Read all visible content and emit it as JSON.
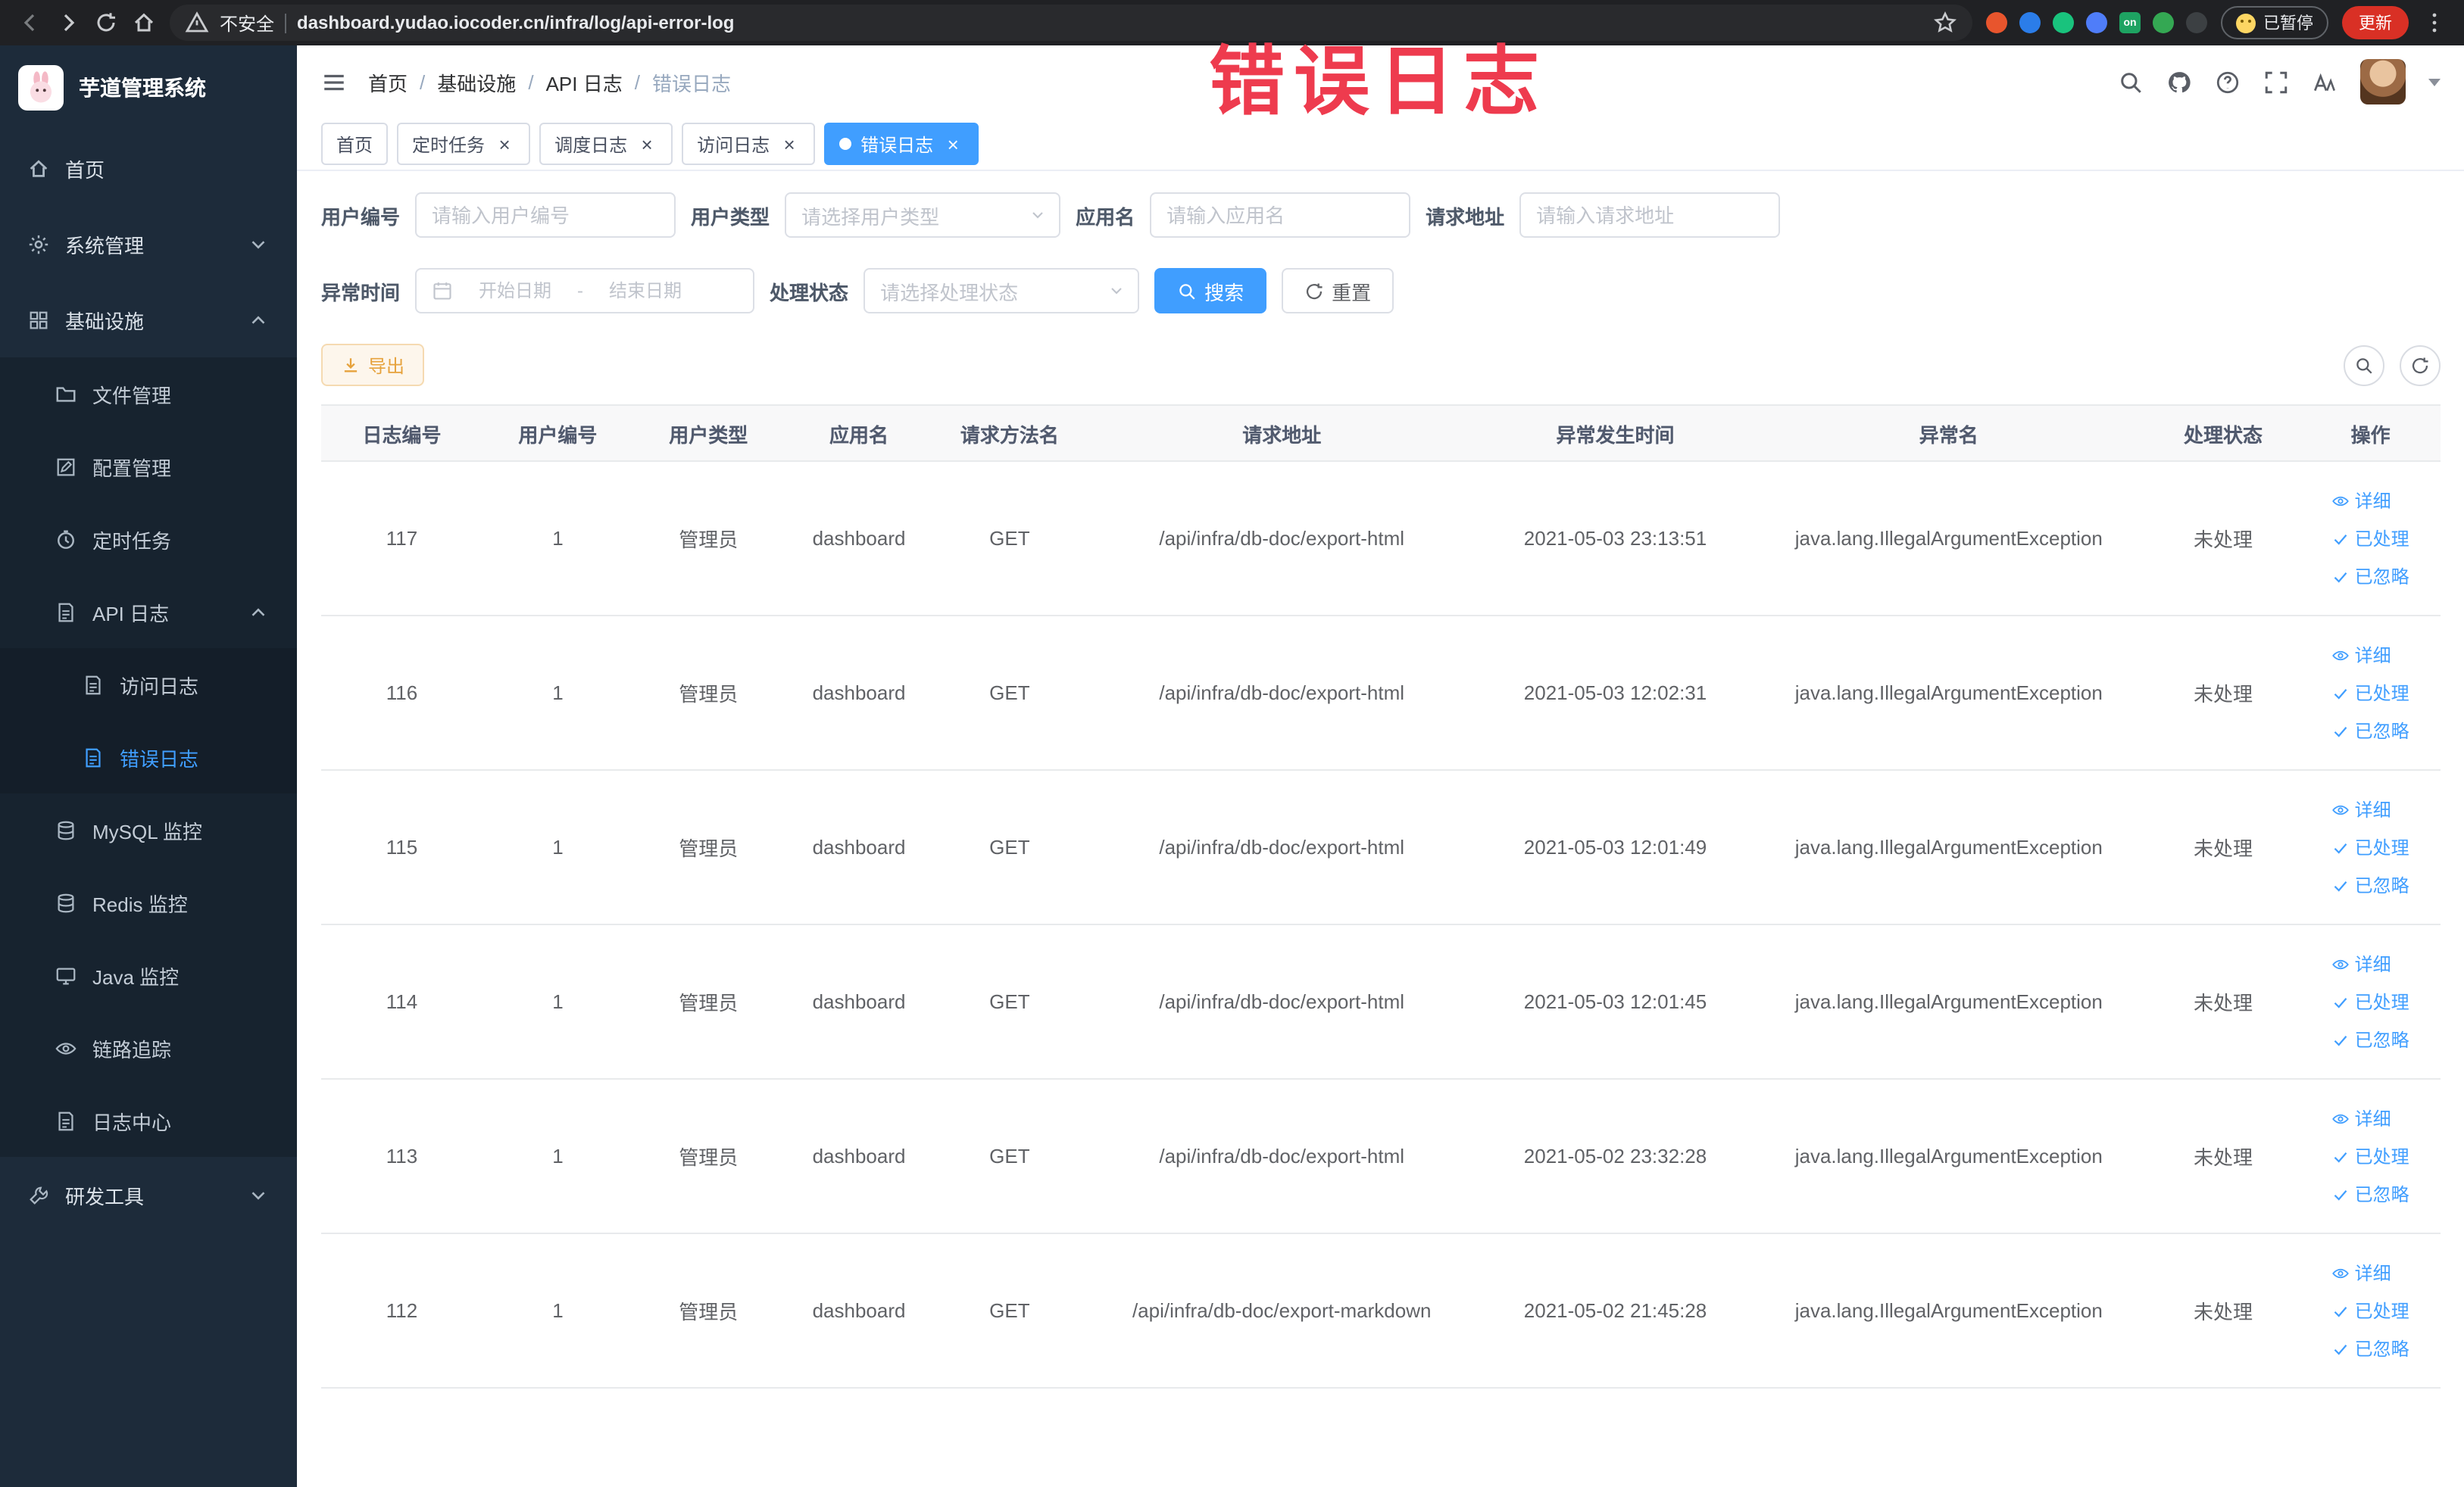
{
  "browser": {
    "security_label": "不安全",
    "url": "dashboard.yudao.iocoder.cn/infra/log/api-error-log",
    "extensions": [
      {
        "color": "#e8552d",
        "label": ""
      },
      {
        "color": "#2b7de9",
        "label": ""
      },
      {
        "color": "#19c37d",
        "label": ""
      },
      {
        "color": "#4f7df9",
        "label": ""
      },
      {
        "color": "#1ea362",
        "label": "on"
      },
      {
        "color": "#34a853",
        "label": ""
      },
      {
        "color": "#3c4043",
        "label": ""
      }
    ],
    "paused_badge": "已暂停",
    "update_button": "更新"
  },
  "watermark": "错误日志",
  "sidebar": {
    "logo_title": "芋道管理系统",
    "items": [
      {
        "key": "home",
        "label": "首页",
        "icon": "home",
        "level": 1
      },
      {
        "key": "system",
        "label": "系统管理",
        "icon": "gear",
        "level": 1,
        "chevron": "down"
      },
      {
        "key": "infra",
        "label": "基础设施",
        "icon": "grid",
        "level": 1,
        "chevron": "up"
      },
      {
        "key": "file",
        "label": "文件管理",
        "icon": "folder",
        "level": 2
      },
      {
        "key": "config",
        "label": "配置管理",
        "icon": "edit",
        "level": 2
      },
      {
        "key": "job",
        "label": "定时任务",
        "icon": "timer",
        "level": 2
      },
      {
        "key": "api-log",
        "label": "API 日志",
        "icon": "doc",
        "level": 2,
        "chevron": "up"
      },
      {
        "key": "access-log",
        "label": "访问日志",
        "icon": "doc",
        "level": 3
      },
      {
        "key": "error-log",
        "label": "错误日志",
        "icon": "doc",
        "level": 3,
        "active": true
      },
      {
        "key": "mysql",
        "label": "MySQL 监控",
        "icon": "db",
        "level": 2
      },
      {
        "key": "redis",
        "label": "Redis 监控",
        "icon": "db",
        "level": 2
      },
      {
        "key": "java",
        "label": "Java 监控",
        "icon": "monitor",
        "level": 2
      },
      {
        "key": "trace",
        "label": "链路追踪",
        "icon": "eye",
        "level": 2
      },
      {
        "key": "log-center",
        "label": "日志中心",
        "icon": "doc",
        "level": 2
      },
      {
        "key": "dev-tools",
        "label": "研发工具",
        "icon": "tools",
        "level": 1,
        "chevron": "down"
      }
    ]
  },
  "header": {
    "breadcrumb": [
      "首页",
      "基础设施",
      "API 日志",
      "错误日志"
    ]
  },
  "tabs": [
    {
      "label": "首页",
      "closable": false,
      "active": false
    },
    {
      "label": "定时任务",
      "closable": true,
      "active": false
    },
    {
      "label": "调度日志",
      "closable": true,
      "active": false
    },
    {
      "label": "访问日志",
      "closable": true,
      "active": false
    },
    {
      "label": "错误日志",
      "closable": true,
      "active": true
    }
  ],
  "filters": {
    "fields": [
      {
        "label": "用户编号",
        "placeholder": "请输入用户编号"
      },
      {
        "label": "用户类型",
        "placeholder": "请选择用户类型"
      },
      {
        "label": "应用名",
        "placeholder": "请输入应用名"
      },
      {
        "label": "请求地址",
        "placeholder": "请输入请求地址"
      },
      {
        "label": "异常时间",
        "start_placeholder": "开始日期",
        "separator": "-",
        "end_placeholder": "结束日期"
      },
      {
        "label": "处理状态",
        "placeholder": "请选择处理状态"
      }
    ],
    "search_label": "搜索",
    "reset_label": "重置"
  },
  "toolbar": {
    "export_label": "导出"
  },
  "table": {
    "columns": [
      "日志编号",
      "用户编号",
      "用户类型",
      "应用名",
      "请求方法名",
      "请求地址",
      "异常发生时间",
      "异常名",
      "处理状态",
      "操作"
    ],
    "row_actions": [
      {
        "key": "detail",
        "label": "详细",
        "icon": "eye"
      },
      {
        "key": "processed",
        "label": "已处理",
        "icon": "check"
      },
      {
        "key": "ignored",
        "label": "已忽略",
        "icon": "check"
      }
    ],
    "rows": [
      {
        "id": "117",
        "user_id": "1",
        "user_type": "管理员",
        "app": "dashboard",
        "method": "GET",
        "url": "/api/infra/db-doc/export-html",
        "time": "2021-05-03 23:13:51",
        "exception": "java.lang.IllegalArgumentException",
        "status": "未处理"
      },
      {
        "id": "116",
        "user_id": "1",
        "user_type": "管理员",
        "app": "dashboard",
        "method": "GET",
        "url": "/api/infra/db-doc/export-html",
        "time": "2021-05-03 12:02:31",
        "exception": "java.lang.IllegalArgumentException",
        "status": "未处理"
      },
      {
        "id": "115",
        "user_id": "1",
        "user_type": "管理员",
        "app": "dashboard",
        "method": "GET",
        "url": "/api/infra/db-doc/export-html",
        "time": "2021-05-03 12:01:49",
        "exception": "java.lang.IllegalArgumentException",
        "status": "未处理"
      },
      {
        "id": "114",
        "user_id": "1",
        "user_type": "管理员",
        "app": "dashboard",
        "method": "GET",
        "url": "/api/infra/db-doc/export-html",
        "time": "2021-05-03 12:01:45",
        "exception": "java.lang.IllegalArgumentException",
        "status": "未处理"
      },
      {
        "id": "113",
        "user_id": "1",
        "user_type": "管理员",
        "app": "dashboard",
        "method": "GET",
        "url": "/api/infra/db-doc/export-html",
        "time": "2021-05-02 23:32:28",
        "exception": "java.lang.IllegalArgumentException",
        "status": "未处理"
      },
      {
        "id": "112",
        "user_id": "1",
        "user_type": "管理员",
        "app": "dashboard",
        "method": "GET",
        "url": "/api/infra/db-doc/export-markdown",
        "time": "2021-05-02 21:45:28",
        "exception": "java.lang.IllegalArgumentException",
        "status": "未处理"
      }
    ]
  },
  "colors": {
    "accent": "#409eff",
    "warning": "#e6a23c",
    "watermark": "#ee3b4e",
    "sidebar_bg": "#1d2b3a",
    "sidebar_sub_bg": "#17232f",
    "table_header_bg": "#f8f8f9"
  }
}
